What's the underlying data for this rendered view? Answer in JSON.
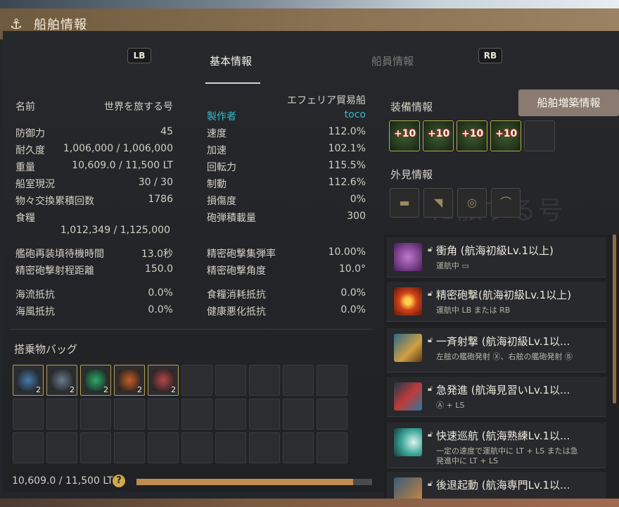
{
  "window": {
    "title": "船舶情報",
    "anchor_icon": "anchor-icon"
  },
  "tabs": {
    "lb": "LB",
    "rb": "RB",
    "active": "基本情報",
    "inactive": "船員情報"
  },
  "left": {
    "name_label": "名前",
    "name_value": "世界を旅する号",
    "stats": [
      {
        "label": "防御力",
        "value": "45"
      },
      {
        "label": "耐久度",
        "value": "1,006,000 / 1,006,000"
      },
      {
        "label": "重量",
        "value": "10,609.0 / 11,500 LT"
      },
      {
        "label": "船室現況",
        "value": "30 / 30"
      },
      {
        "label": "物々交換累積回数",
        "value": "1786"
      },
      {
        "label": "食糧",
        "value": ""
      }
    ],
    "food_value": "1,012,349 / 1,125,000",
    "stats2": [
      {
        "label": "艦砲再装填待機時間",
        "value": "13.0秒"
      },
      {
        "label": "精密砲撃射程距離",
        "value": "150.0"
      }
    ],
    "stats3": [
      {
        "label": "海流抵抗",
        "value": "0.0%"
      },
      {
        "label": "海風抵抗",
        "value": "0.0%"
      }
    ]
  },
  "middle": {
    "ship_type": "エフェリア貿易船",
    "maker_label": "製作者",
    "maker_value": "toco",
    "stats": [
      {
        "label": "速度",
        "value": "112.0%"
      },
      {
        "label": "加速",
        "value": "102.1%"
      },
      {
        "label": "回転力",
        "value": "115.5%"
      },
      {
        "label": "制動",
        "value": "112.6%"
      },
      {
        "label": "損傷度",
        "value": "0%"
      },
      {
        "label": "砲弾積載量",
        "value": "300"
      }
    ],
    "stats2": [
      {
        "label": "精密砲撃集弾率",
        "value": "10.00%"
      },
      {
        "label": "精密砲撃角度",
        "value": "10.0°"
      }
    ],
    "stats3": [
      {
        "label": "食糧消耗抵抗",
        "value": "0.0%"
      },
      {
        "label": "健康悪化抵抗",
        "value": "0.0%"
      }
    ]
  },
  "right": {
    "build_button": "船舶増築情報",
    "equip_title": "装備情報",
    "equip_plus": [
      "+10",
      "+10",
      "+10",
      "+10"
    ],
    "look_title": "外見情報",
    "bg_text": "に旅する号"
  },
  "bag": {
    "title": "搭乗物バッグ",
    "items": [
      {
        "icon": "key-icon",
        "count": "2",
        "color": "#4a7aa8"
      },
      {
        "icon": "dragon-statue-icon",
        "count": "2",
        "color": "#6a7a88"
      },
      {
        "icon": "emerald-icon",
        "count": "2",
        "color": "#2ea86a"
      },
      {
        "icon": "ore-icon",
        "count": "2",
        "color": "#c0602a"
      },
      {
        "icon": "scroll-icon",
        "count": "2",
        "color": "#b04a4a"
      }
    ],
    "weight": "10,609.0 / 11,500 LT",
    "weight_fraction": 0.92
  },
  "skills": [
    {
      "name": "衝角 (航海初級Lv.1以上)",
      "desc": "運航中 ▭",
      "desc2": "",
      "color": "#8a3aa8"
    },
    {
      "name": "精密砲撃(航海初級Lv.1以上)",
      "desc": "運航中 LB または RB",
      "desc2": "",
      "color": "#d0401a"
    },
    {
      "name": "一斉射撃 (航海初級Lv.1以...",
      "desc": "左舷の艦砲発射 Ⓧ、右舷の艦砲発射 Ⓑ",
      "desc2": "",
      "color": "#c08a2a"
    },
    {
      "name": "急発進 (航海見習いLv.1以...",
      "desc": "Ⓐ + LS",
      "desc2": "",
      "color": "#2a8aa8"
    },
    {
      "name": "快速巡航 (航海熟練Lv.1以...",
      "desc": "一定の速度で運航中に LT + LS または急",
      "desc2": "発進中に LT + LS",
      "color": "#3aa89a"
    },
    {
      "name": "後退起動 (航海専門Lv.1以...",
      "desc": "",
      "desc2": "",
      "color": "#d08a3a"
    }
  ]
}
